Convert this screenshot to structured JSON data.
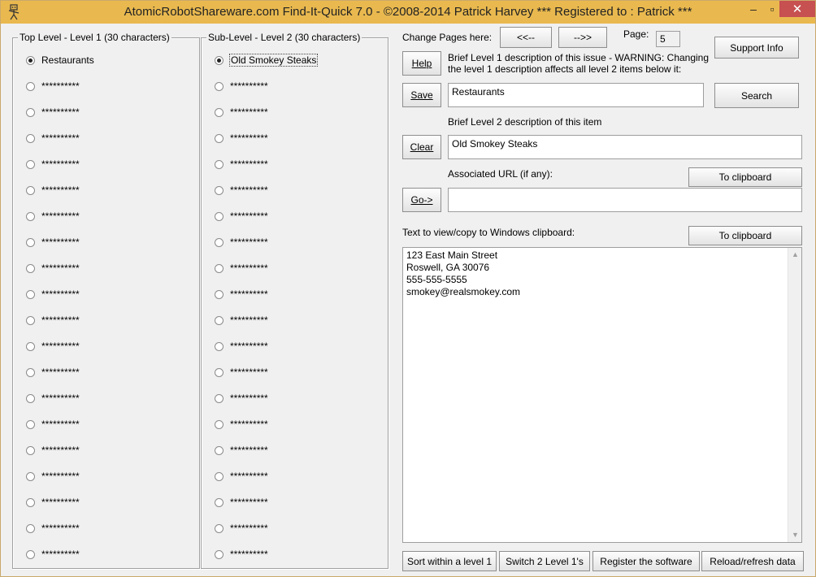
{
  "window": {
    "title": "AtomicRobotShareware.com Find-It-Quick 7.0 - ©2008-2014 Patrick Harvey *** Registered to : Patrick ***",
    "minimize": "–",
    "maximize": "▫",
    "close": "✕"
  },
  "level1": {
    "legend": "Top Level - Level 1 (30 characters)",
    "items": [
      "Restaurants",
      "**********",
      "**********",
      "**********",
      "**********",
      "**********",
      "**********",
      "**********",
      "**********",
      "**********",
      "**********",
      "**********",
      "**********",
      "**********",
      "**********",
      "**********",
      "**********",
      "**********",
      "**********",
      "**********"
    ],
    "selected_index": 0
  },
  "level2": {
    "legend": "Sub-Level - Level 2 (30 characters)",
    "items": [
      "Old Smokey Steaks",
      "**********",
      "**********",
      "**********",
      "**********",
      "**********",
      "**********",
      "**********",
      "**********",
      "**********",
      "**********",
      "**********",
      "**********",
      "**********",
      "**********",
      "**********",
      "**********",
      "**********",
      "**********",
      "**********"
    ],
    "selected_index": 0
  },
  "paging": {
    "label": "Change Pages here:",
    "prev": "<<--",
    "next": "-->>",
    "page_label": "Page:",
    "page_value": "5"
  },
  "buttons": {
    "help": "Help",
    "save": "Save",
    "clear": "Clear",
    "go": "Go->",
    "support": "Support Info",
    "search": "Search",
    "to_clipboard_url": "To clipboard",
    "to_clipboard_text": "To clipboard"
  },
  "fields": {
    "level1_desc_label_line1": "Brief Level 1 description of this issue - WARNING: Changing",
    "level1_desc_label_line2": "the level 1 description affects all level 2 items below it:",
    "level1_desc_value": "Restaurants",
    "level2_desc_label": "Brief Level 2 description of this item",
    "level2_desc_value": "Old Smokey Steaks",
    "url_label": "Associated URL (if any):",
    "url_value": "",
    "text_label": "Text to view/copy to Windows clipboard:",
    "text_lines": [
      "123 East Main Street",
      "Roswell, GA  30076",
      "555-555-5555",
      "smokey@realsmokey.com"
    ]
  },
  "bottom_buttons": {
    "sort": "Sort within a level 1",
    "switch": "Switch 2 Level 1's",
    "register": "Register the software",
    "reload": "Reload/refresh data"
  }
}
